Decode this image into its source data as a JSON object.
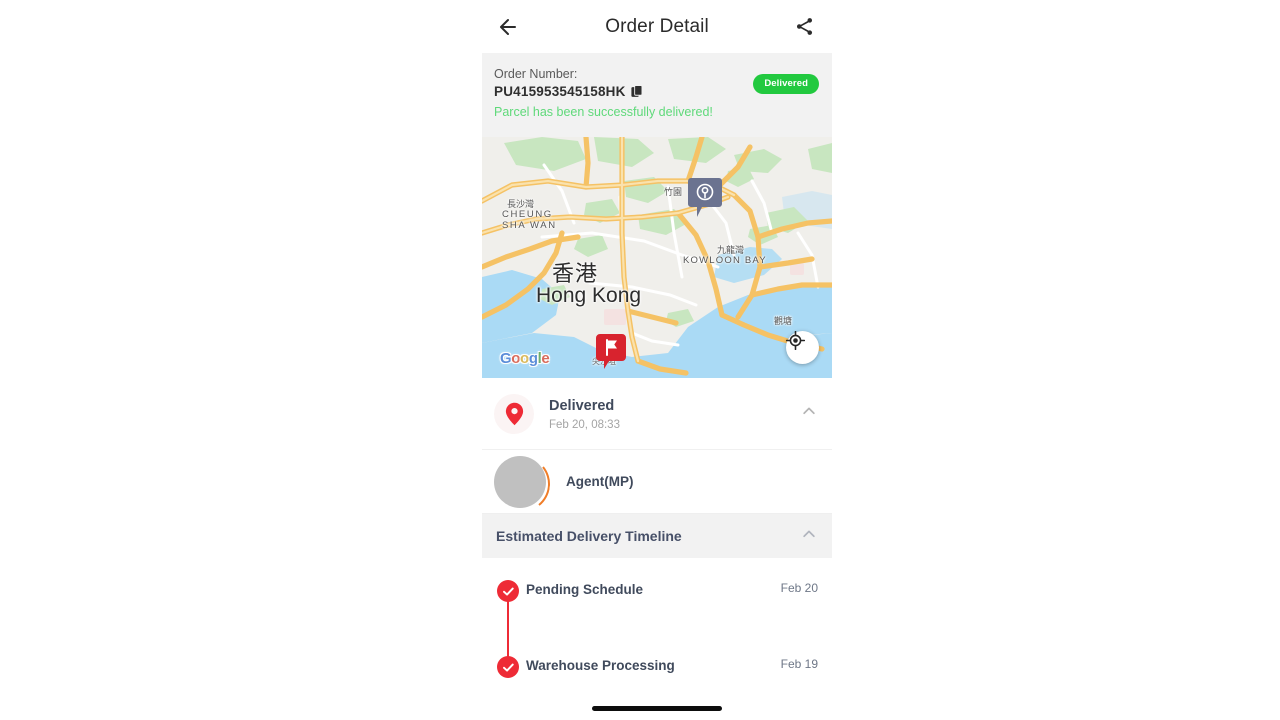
{
  "header": {
    "title": "Order Detail",
    "back_icon": "arrow-left-icon",
    "share_icon": "share-icon"
  },
  "order": {
    "label": "Order Number:",
    "number": "PU415953545158HK",
    "copy_icon": "copy-icon",
    "message": "Parcel has been successfully delivered!",
    "badge": "Delivered",
    "badge_color": "#22c93f",
    "message_color": "#5fd97a"
  },
  "map": {
    "city_cn": "香港",
    "city_en": "Hong Kong",
    "cheung_sha_wan_cn": "長沙灣",
    "cheung_sha_wan_en_1": "CHEUNG",
    "cheung_sha_wan_en_2": "SHA WAN",
    "kowloon_bay_cn": "九龍灣",
    "kowloon_bay_en": "KOWLOON BAY",
    "zhu_yuan": "竹園",
    "kwun_tong": "觀塘",
    "tsim_sha_tsui": "尖沙咀",
    "attribution": "Google",
    "attribution_letters": [
      "G",
      "o",
      "o",
      "g",
      "l",
      "e"
    ],
    "destination_marker_icon": "map-pin-marker-icon",
    "origin_marker_icon": "flag-marker-icon",
    "locate_icon": "my-location-icon",
    "road_color": "#f8d47c",
    "water_color": "#aadaf5",
    "park_color": "#c8e6c0",
    "land_color": "#f0efeb"
  },
  "status": {
    "pin_icon": "location-pin-icon",
    "title": "Delivered",
    "subtitle": "Feb 20, 08:33",
    "chevron_icon": "chevron-up-icon"
  },
  "agent": {
    "avatar_icon": "avatar",
    "name": "Agent(MP)"
  },
  "timeline": {
    "header_title": "Estimated Delivery Timeline",
    "chevron_icon": "chevron-up-icon",
    "items": [
      {
        "name": "Pending Schedule",
        "date": "Feb 20",
        "icon": "check-circle-icon",
        "done": true
      },
      {
        "name": "Warehouse Processing",
        "date": "Feb 19",
        "icon": "check-circle-icon",
        "done": true
      }
    ]
  },
  "system": {
    "home_indicator": "home-indicator"
  }
}
